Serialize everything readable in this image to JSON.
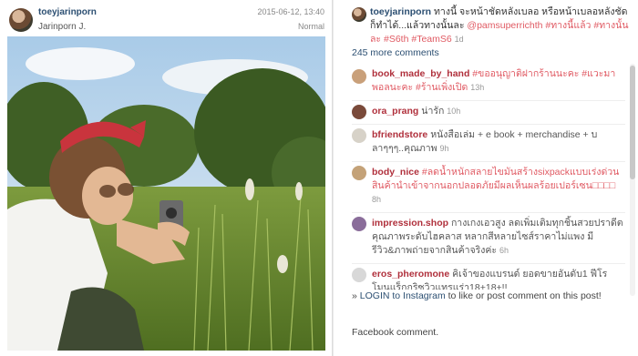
{
  "post": {
    "username": "toeyjarinporn",
    "full_name": "Jarinporn J.",
    "date": "2015-06-12, 13:40",
    "filter": "Normal"
  },
  "caption": {
    "username": "toeyjarinporn",
    "text": "ทางนี้ จะหน้าชัดหลังเบลอ หรือหน้าเบลอหลังชัดก็ทำได้...แล้วทางนั้นละ",
    "mention": "@pamsuperrichth",
    "tags": "#ทางนี้แล้ว #ทางนั้นละ #S6th #TeamS6",
    "ago": "1d"
  },
  "more_comments": "245 more comments",
  "comments": [
    {
      "user": "book_made_by_hand",
      "text": "",
      "tags": "#ขออนุญาติฝากร้านนะคะ #แวะมาพอลนะคะ #ร้านเพิ่งเปิด",
      "ago": "13h",
      "avatar": "#c9a07a"
    },
    {
      "user": "ora_prang",
      "text": "น่ารัก",
      "tags": "",
      "ago": "10h",
      "avatar": "#7a4a3a"
    },
    {
      "user": "bfriendstore",
      "text": "หนังสือเล่ม + e book + merchandise + บลาๆๆๆ..คุณภาพ",
      "tags": "",
      "ago": "9h",
      "avatar": "#d7d2c8"
    },
    {
      "user": "body_nice",
      "text": "ลดน้ำหนักสลายไขมันสร้างsixpackแบบเร่งด่วนสินค้านำเข้าจากนอกปลอดภัยมีผลเห็นผลร้อยเปอร์เซน□□□□ แก้อาการโยโย่ เอฟเฟค",
      "tags": "#ลดน้ำหนักสลายไขมันสร้างsixpackแบบเร่งด่วนสินค้านำเข้าจากนอกปลอดภัยมีผลเห็นผลร้อยเปอร์เซน□□□□",
      "ago": "8h",
      "avatar": "#c4a278"
    },
    {
      "user": "impression.shop",
      "text": "กางเกงเอวสูง ลดเพิ่มเติมทุกชิ้นสวยปราดีต คุณภาพระดับไฮคลาส หลากสีหลายไซส์ราคาไม่แพง มีรีวิว&ภาพถ่ายจากสินค้าจริงค่ะ",
      "tags": "",
      "ago": "6h",
      "avatar": "#8a6d9a"
    },
    {
      "user": "eros_pheromone",
      "text": "คิเจ้าของแบรนด์ ยอดขายอันดับ1 ฟีโรโมนแร็กกริซวิวแทรแร่า18+18+!!",
      "tags": "",
      "ago": "",
      "avatar": "#d8d8d8"
    }
  ],
  "login": {
    "prefix": "» ",
    "link": "LOGIN to Instagram",
    "suffix": " to like or post comment on this post!"
  },
  "facebook": "Facebook comment."
}
